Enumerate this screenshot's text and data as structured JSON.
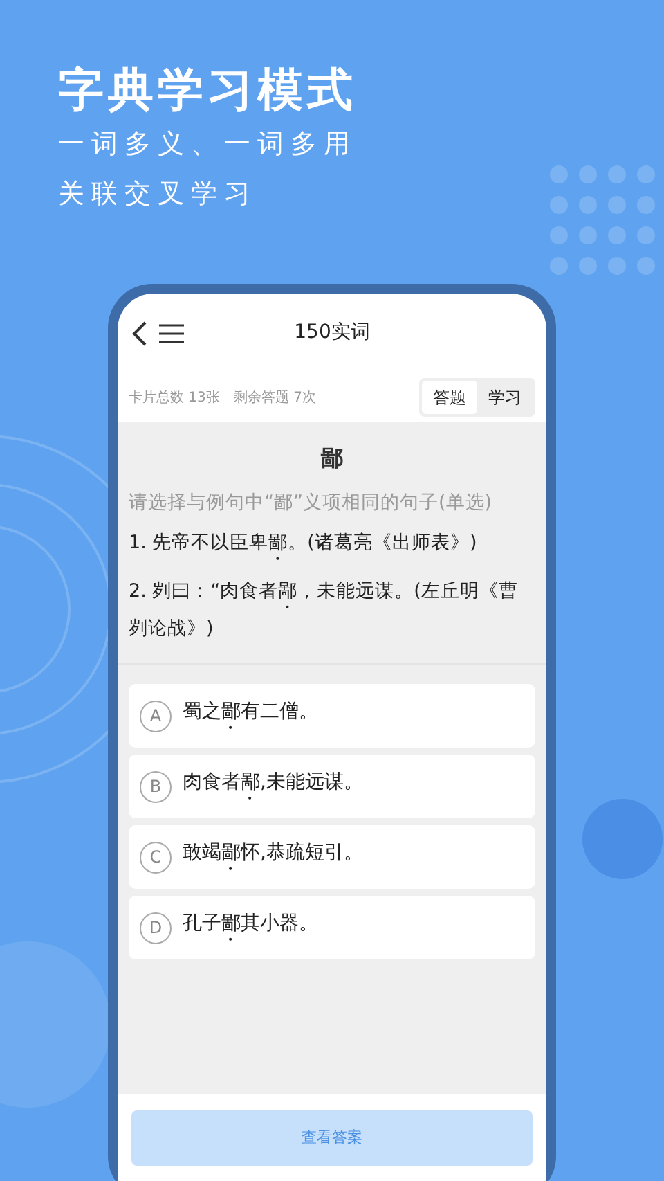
{
  "promo": {
    "title": "字典学习模式",
    "subtitle_lines": [
      "一词多义、一词多用",
      "关联交叉学习"
    ]
  },
  "header": {
    "title": "150实词"
  },
  "stats": [
    "卡片总数 13张",
    "剩余答题 7次"
  ],
  "mode_tabs": [
    {
      "label": "答题",
      "selected": true
    },
    {
      "label": "学习",
      "selected": false
    }
  ],
  "question": {
    "character": "鄙",
    "instruction": "请选择与例句中“鄙”义项相同的句子(单选)",
    "examples": [
      [
        {
          "text": "1. 先帝不以臣卑",
          "kind": "plain"
        },
        {
          "text": "鄙",
          "kind": "dotted"
        },
        {
          "text": "。(诸葛亮《出师表》)",
          "kind": "plain"
        }
      ],
      [
        {
          "text": "2. 刿曰：“肉食者",
          "kind": "plain"
        },
        {
          "text": "鄙",
          "kind": "dotted"
        },
        {
          "text": "，未能远谋。(左丘明《曹刿论战》)",
          "kind": "plain"
        }
      ]
    ]
  },
  "options": [
    {
      "letter": "A",
      "segments": [
        {
          "text": "蜀之",
          "kind": "plain"
        },
        {
          "text": "鄙",
          "kind": "dotted"
        },
        {
          "text": "有二僧。",
          "kind": "plain"
        }
      ]
    },
    {
      "letter": "B",
      "segments": [
        {
          "text": "肉食者",
          "kind": "plain"
        },
        {
          "text": "鄙",
          "kind": "dotted"
        },
        {
          "text": ",未能远谋。",
          "kind": "plain"
        }
      ]
    },
    {
      "letter": "C",
      "segments": [
        {
          "text": "敢竭",
          "kind": "plain"
        },
        {
          "text": "鄙",
          "kind": "dotted"
        },
        {
          "text": "怀,恭疏短引。",
          "kind": "plain"
        }
      ]
    },
    {
      "letter": "D",
      "segments": [
        {
          "text": "孔子",
          "kind": "plain"
        },
        {
          "text": "鄙",
          "kind": "dotted"
        },
        {
          "text": "其小器。",
          "kind": "plain"
        }
      ]
    }
  ],
  "answer_button": "查看答案"
}
